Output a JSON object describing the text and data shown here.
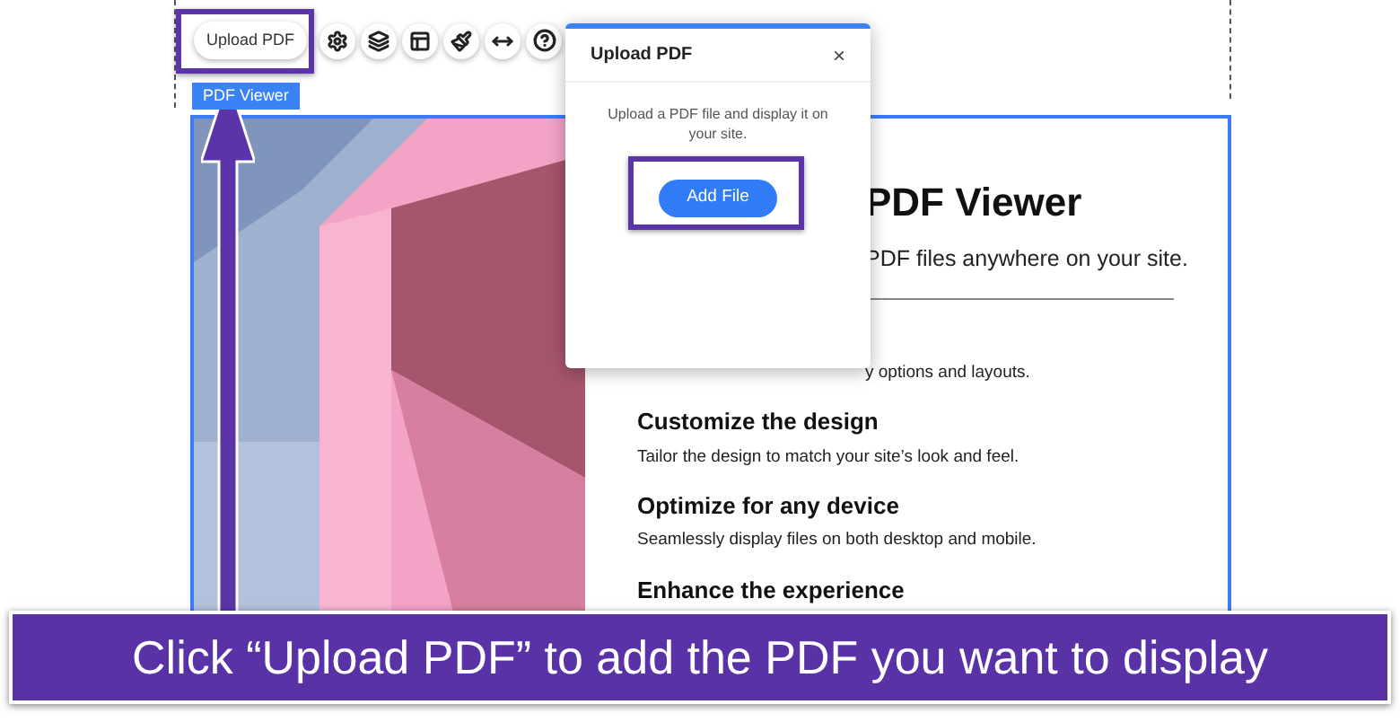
{
  "toolbar": {
    "upload_button": "Upload PDF"
  },
  "element_tag": "PDF Viewer",
  "popup": {
    "title": "Upload PDF",
    "close": "×",
    "description": "Upload a PDF file and display it on your site.",
    "button": "Add File"
  },
  "page": {
    "title": "PDF Viewer",
    "subtitle": "PDF files anywhere on your site.",
    "features": [
      {
        "text": "y options and layouts."
      },
      {
        "heading": "Customize the design",
        "text": "Tailor the design to match your site’s look and feel."
      },
      {
        "heading": "Optimize for any device",
        "text": "Seamlessly display files on both desktop and mobile."
      },
      {
        "heading": "Enhance the experience"
      }
    ]
  },
  "caption": "Click “Upload PDF” to add the PDF you want to display"
}
